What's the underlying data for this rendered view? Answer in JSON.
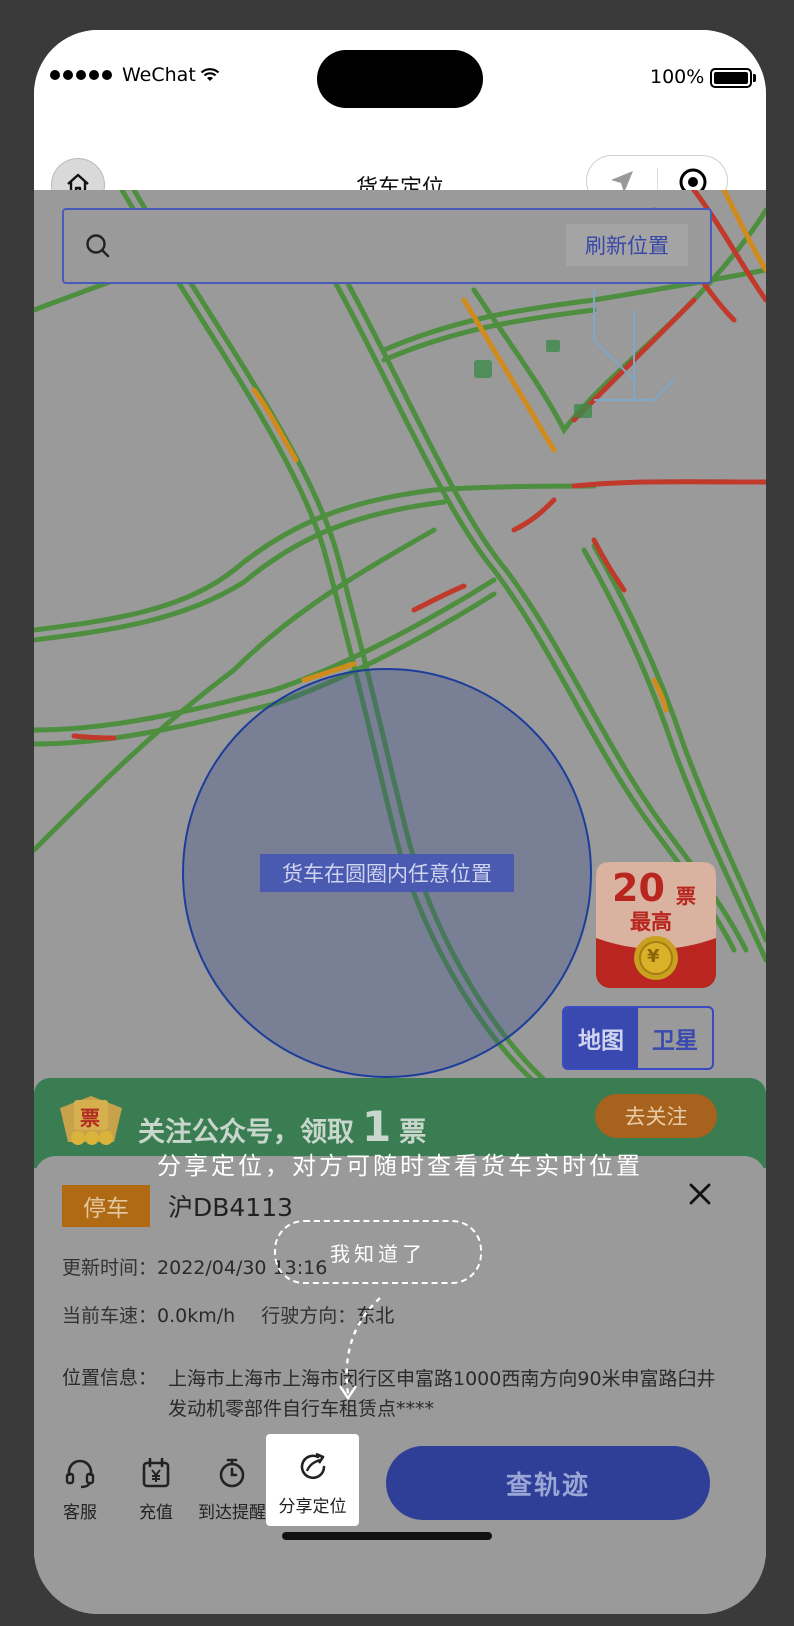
{
  "status_bar": {
    "carrier": "WeChat",
    "battery": "100%"
  },
  "nav": {
    "title": "货车定位"
  },
  "search": {
    "refresh_label": "刷新位置"
  },
  "map": {
    "circle_label": "货车在圆圈内任意位置",
    "promo": {
      "number": "20",
      "unit": "票",
      "subtitle": "最高",
      "coin": "¥"
    },
    "toggle": {
      "map": "地图",
      "satellite": "卫星"
    }
  },
  "follow_banner": {
    "ticket_icon_text": "票",
    "text_before": "关注公众号，领取",
    "count": "1",
    "text_after": "票",
    "button": "去关注"
  },
  "truck": {
    "status_tag": "停车",
    "plate": "沪DB4113",
    "update_label": "更新时间：",
    "update_value": "2022/04/30 13:16",
    "speed_label": "当前车速：",
    "speed_value": "0.0km/h",
    "direction_label": "行驶方向：",
    "direction_value": "东北",
    "location_label": "位置信息：",
    "location_value": "上海市上海市上海市闵行区申富路1000西南方向90米申富路臼井发动机零部件自行车租赁点****"
  },
  "toolbar": {
    "service": "客服",
    "recharge": "充值",
    "arrival_reminder": "到达提醒",
    "share_location": "分享定位",
    "track_button": "查轨迹"
  },
  "guide": {
    "text": "分享定位，对方可随时查看货车实时位置",
    "dismiss": "我知道了"
  },
  "colors": {
    "accent_blue": "#3949b0",
    "follow_green": "#3b7d53",
    "parking_orange": "#b06a14",
    "road_green": "#4d8e3f",
    "road_red": "#c0392b",
    "road_orange": "#d08b1c"
  }
}
